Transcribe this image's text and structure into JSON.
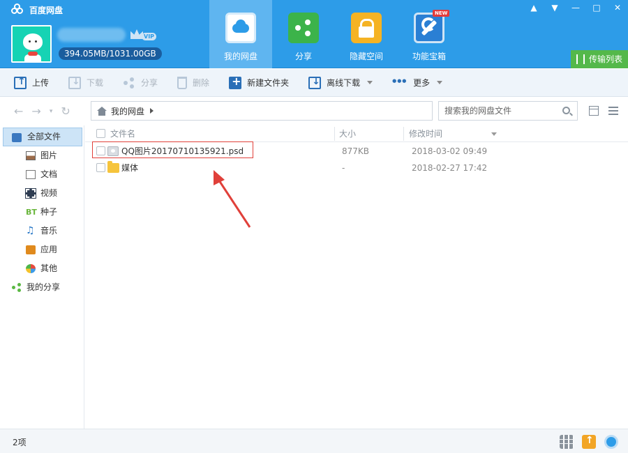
{
  "app": {
    "title": "百度网盘"
  },
  "account": {
    "vip_label": "VIP",
    "quota": "394.05MB/1031.00GB"
  },
  "nav": [
    {
      "label": "我的网盘",
      "icon": "cloud-icon",
      "active": true
    },
    {
      "label": "分享",
      "icon": "share-icon",
      "active": false
    },
    {
      "label": "隐藏空间",
      "icon": "lock-icon",
      "active": false
    },
    {
      "label": "功能宝箱",
      "icon": "toolbox-icon",
      "active": false,
      "badge": "NEW"
    }
  ],
  "window": {
    "controls": [
      "▲",
      "▼",
      "—",
      "□",
      "✕"
    ]
  },
  "transfer": {
    "label": "传输列表"
  },
  "toolbar": {
    "upload": "上传",
    "download": "下载",
    "share": "分享",
    "delete": "删除",
    "new_folder": "新建文件夹",
    "offline_download": "离线下载",
    "more": "更多"
  },
  "address": {
    "breadcrumb": "我的网盘",
    "search_placeholder": "搜索我的网盘文件"
  },
  "sidebar": {
    "items": [
      {
        "label": "全部文件",
        "icon": "folder-icon",
        "active": true
      },
      {
        "label": "图片",
        "icon": "picture-icon"
      },
      {
        "label": "文档",
        "icon": "document-icon"
      },
      {
        "label": "视频",
        "icon": "video-icon"
      },
      {
        "label": "种子",
        "icon": "bt-icon",
        "glyph": "BT"
      },
      {
        "label": "音乐",
        "icon": "music-icon",
        "glyph": "♫"
      },
      {
        "label": "应用",
        "icon": "app-icon"
      },
      {
        "label": "其他",
        "icon": "other-icon"
      },
      {
        "label": "我的分享",
        "icon": "share-icon"
      }
    ]
  },
  "files": {
    "headers": {
      "name": "文件名",
      "size": "大小",
      "modified": "修改时间"
    },
    "rows": [
      {
        "name": "QQ图片20170710135921.psd",
        "size": "877KB",
        "modified": "2018-03-02 09:49",
        "icon": "psd-file-icon"
      },
      {
        "name": "媒体",
        "size": "-",
        "modified": "2018-02-27 17:42",
        "icon": "folder-icon"
      }
    ]
  },
  "status": {
    "count": "2项"
  },
  "colors": {
    "header_bg": "#2d9ce8",
    "accent_green": "#54b84a",
    "highlight_red": "#e0403a"
  }
}
